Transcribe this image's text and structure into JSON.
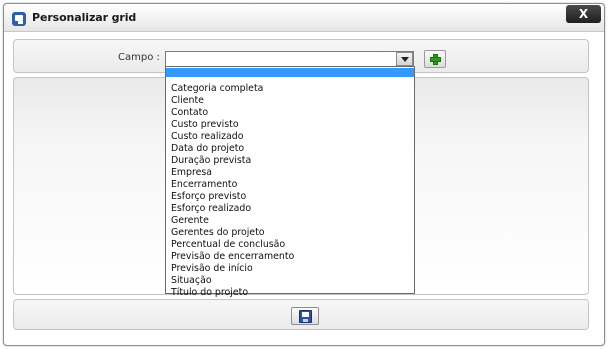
{
  "window": {
    "title": "Personalizar grid",
    "close_label": "X"
  },
  "form": {
    "field_label": "Campo :",
    "select_value": ""
  },
  "dropdown": {
    "options": [
      "",
      "Categoria completa",
      "Cliente",
      "Contato",
      "Custo previsto",
      "Custo realizado",
      "Data do projeto",
      "Duração prevista",
      "Empresa",
      "Encerramento",
      "Esforço previsto",
      "Esforço realizado",
      "Gerente",
      "Gerentes do projeto",
      "Percentual de conclusão",
      "Previsão de encerramento",
      "Previsão de início",
      "Situação",
      "Título do projeto"
    ],
    "selected_index": 0
  },
  "icons": {
    "title_logo": "app-logo-icon",
    "add": "plus-icon",
    "save": "floppy-disk-icon",
    "dropdown_arrow": "chevron-down-icon"
  },
  "colors": {
    "selection": "#3399ff",
    "close_button": "#2a2a2a",
    "add_icon": "#2f9a21",
    "save_icon": "#2d4fa6"
  }
}
